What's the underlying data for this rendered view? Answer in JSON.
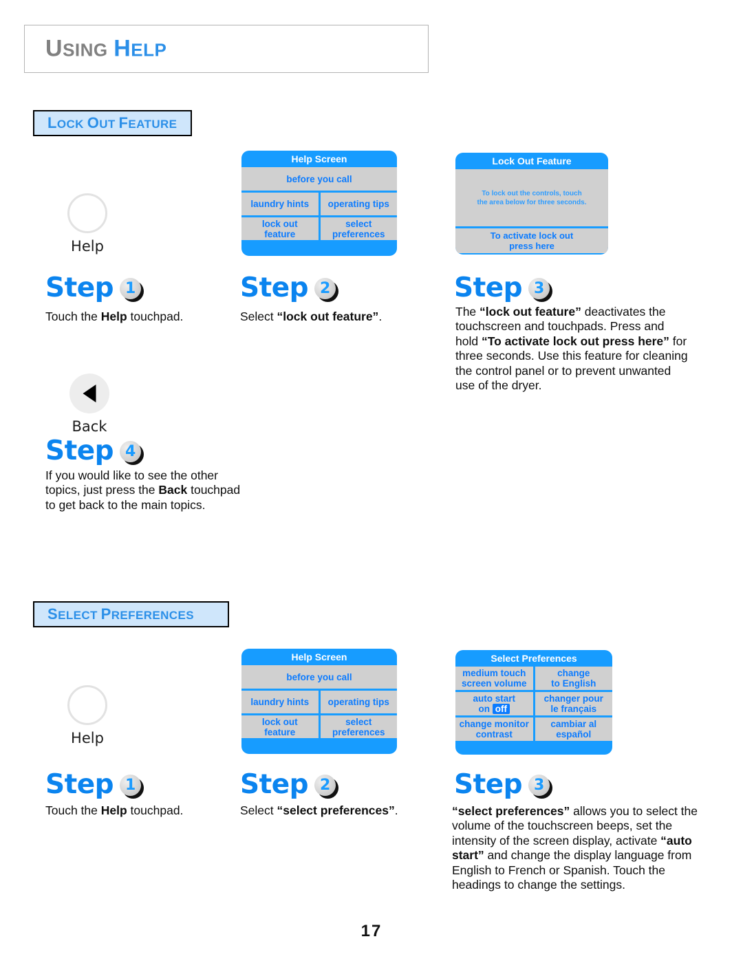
{
  "page": {
    "title_first_cap": "U",
    "title_first_rest": "SING",
    "title_second_cap": "H",
    "title_second_rest": "ELP",
    "number": "17"
  },
  "sections": {
    "lock_out": {
      "badge_cap1": "L",
      "badge_rest1": "OCK",
      "badge_cap2": "O",
      "badge_rest2": "UT",
      "badge_cap3": "F",
      "badge_rest3": "EATURE"
    },
    "select_preferences": {
      "badge_cap1": "S",
      "badge_rest1": "ELECT",
      "badge_cap2": "P",
      "badge_rest2": "REFERENCES"
    }
  },
  "touchpads": {
    "help": {
      "label": "Help",
      "icon": "circle-outline-icon"
    },
    "back": {
      "label": "Back",
      "icon": "left-triangle-icon"
    }
  },
  "panels": {
    "help_screen": {
      "title": "Help Screen",
      "rows": [
        [
          "before you call"
        ],
        [
          "laundry hints",
          "operating tips"
        ],
        [
          "lock out\nfeature",
          "select\npreferences"
        ]
      ],
      "cells": {
        "before_you_call": "before you call",
        "laundry_hints": "laundry hints",
        "operating_tips": "operating tips",
        "lock_out_line1": "lock out",
        "lock_out_line2": "feature",
        "select_line1": "select",
        "select_line2": "preferences"
      }
    },
    "lock_out_feature": {
      "title": "Lock Out Feature",
      "body_line1": "To lock out the controls, touch",
      "body_line2": "the area below for three seconds.",
      "press_line1": "To activate lock out",
      "press_line2": "press here"
    },
    "select_preferences": {
      "title": "Select Preferences",
      "cells": {
        "volume_line1": "medium touch",
        "volume_line2": "screen volume",
        "english_line1": "change",
        "english_line2": "to English",
        "autostart_line1": "auto start",
        "autostart_on": "on",
        "autostart_off": "off",
        "french_line1": "changer pour",
        "french_line2": "le français",
        "contrast_line1": "change monitor",
        "contrast_line2": "contrast",
        "spanish_line1": "cambiar al",
        "spanish_line2": "español"
      }
    }
  },
  "lock_out_steps": {
    "step1": {
      "word": "Step",
      "number": "1",
      "text_pre": "Touch the ",
      "text_bold": "Help",
      "text_post": " touchpad."
    },
    "step2": {
      "word": "Step",
      "number": "2",
      "text_pre": "Select ",
      "text_bold": "“lock out feature”",
      "text_post": "."
    },
    "step3": {
      "word": "Step",
      "number": "3",
      "p1_pre": "The ",
      "p1_bold": "“lock out feature”",
      "p1_mid": " deactivates the touchscreen and touchpads.  Press and hold ",
      "p1_bold2": "“To activate lock out press here”",
      "p1_post": " for three seconds.  Use this feature for cleaning the control panel or to prevent unwanted use of the dryer."
    },
    "step4": {
      "word": "Step",
      "number": "4",
      "p_pre": "If you would like to see the other topics, just press the ",
      "p_bold": "Back",
      "p_post": " touchpad to get back to the main topics."
    }
  },
  "preference_steps": {
    "step1": {
      "word": "Step",
      "number": "1",
      "text_pre": "Touch the ",
      "text_bold": "Help",
      "text_post": " touchpad."
    },
    "step2": {
      "word": "Step",
      "number": "2",
      "text_pre": "Select ",
      "text_bold": "“select preferences”",
      "text_post": "."
    },
    "step3": {
      "word": "Step",
      "number": "3",
      "p_bold1": "“select preferences”",
      "p_mid1": " allows you to select the volume of the touchscreen beeps, set the intensity of the screen display, activate ",
      "p_bold2": "“auto start”",
      "p_post": " and change the display language from English to French or Spanish. Touch the headings to change the settings."
    }
  },
  "colors": {
    "accent_blue": "#2b8fe8",
    "screen_blue": "#179cff",
    "screen_gray": "#d0d0d0",
    "badge_bg": "#cfe6fb"
  }
}
